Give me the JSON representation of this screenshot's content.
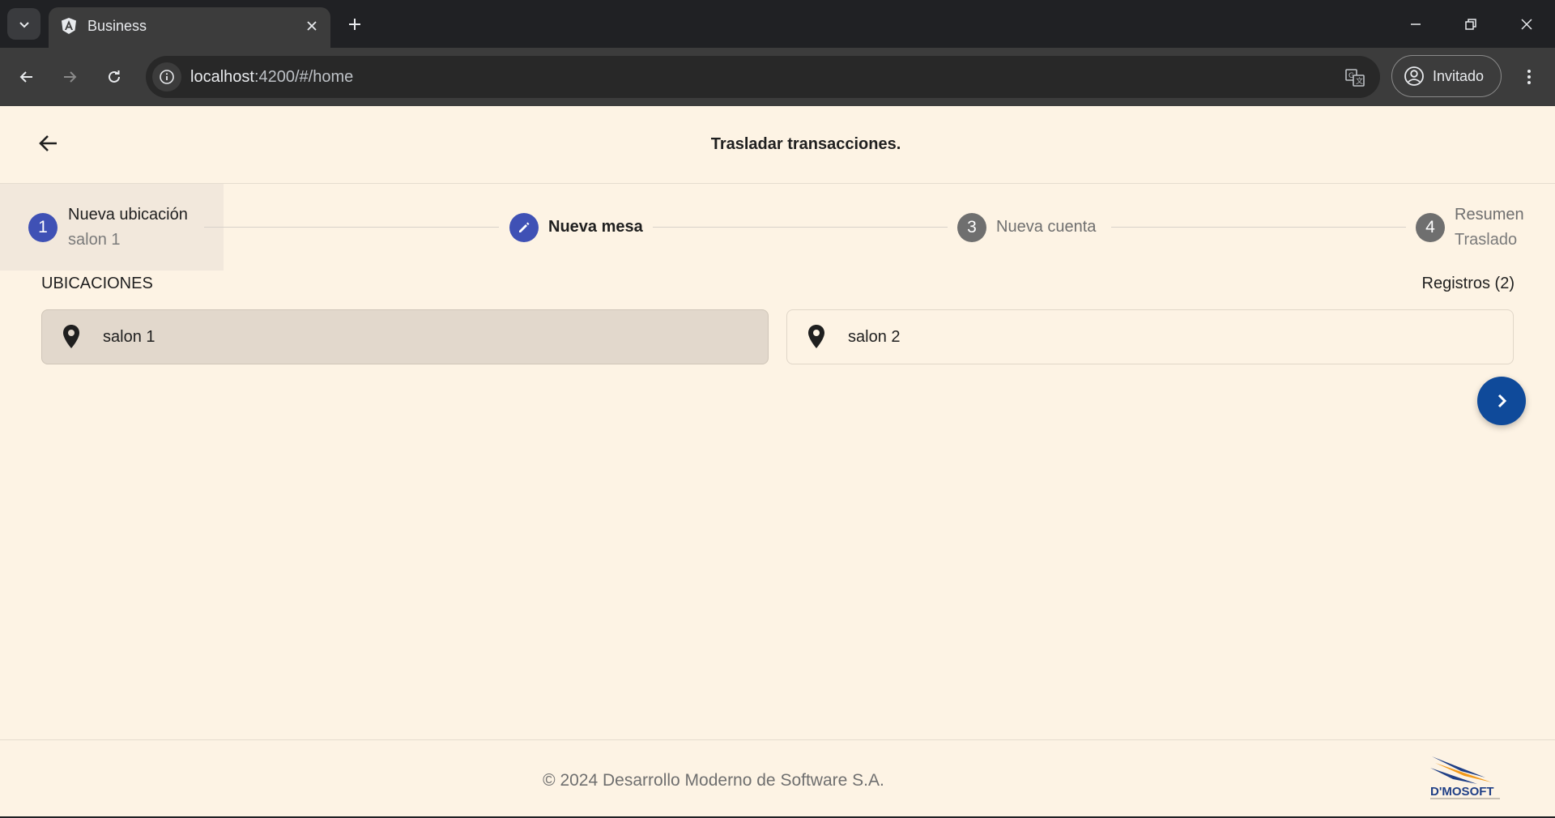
{
  "browser": {
    "tab_title": "Business",
    "url_host": "localhost",
    "url_rest": ":4200/#/home",
    "profile_label": "Invitado"
  },
  "app": {
    "page_title": "Trasladar transacciones.",
    "stepper": {
      "steps": [
        {
          "number": "1",
          "label": "Nueva ubicación",
          "sublabel": "salon 1",
          "state": "done"
        },
        {
          "number": "2",
          "label": "Nueva mesa",
          "sublabel": "",
          "state": "editing"
        },
        {
          "number": "3",
          "label": "Nueva cuenta",
          "sublabel": "",
          "state": "pending"
        },
        {
          "number": "4",
          "label": "Resumen",
          "sublabel": "Traslado",
          "state": "pending"
        }
      ]
    },
    "locations": {
      "title": "UBICACIONES",
      "records_label": "Registros (2)",
      "items": [
        {
          "label": "salon 1",
          "selected": true
        },
        {
          "label": "salon 2",
          "selected": false
        }
      ]
    },
    "footer": {
      "copyright": "© 2024 Desarrollo Moderno de Software S.A.",
      "logo_text": "D'MOSOFT"
    }
  },
  "colors": {
    "step_active": "#3f51b5",
    "step_pending": "#6f6f6f",
    "fab": "#0f4a9a",
    "page_bg": "#fdf3e4",
    "selected_card": "#e2d8cc"
  }
}
